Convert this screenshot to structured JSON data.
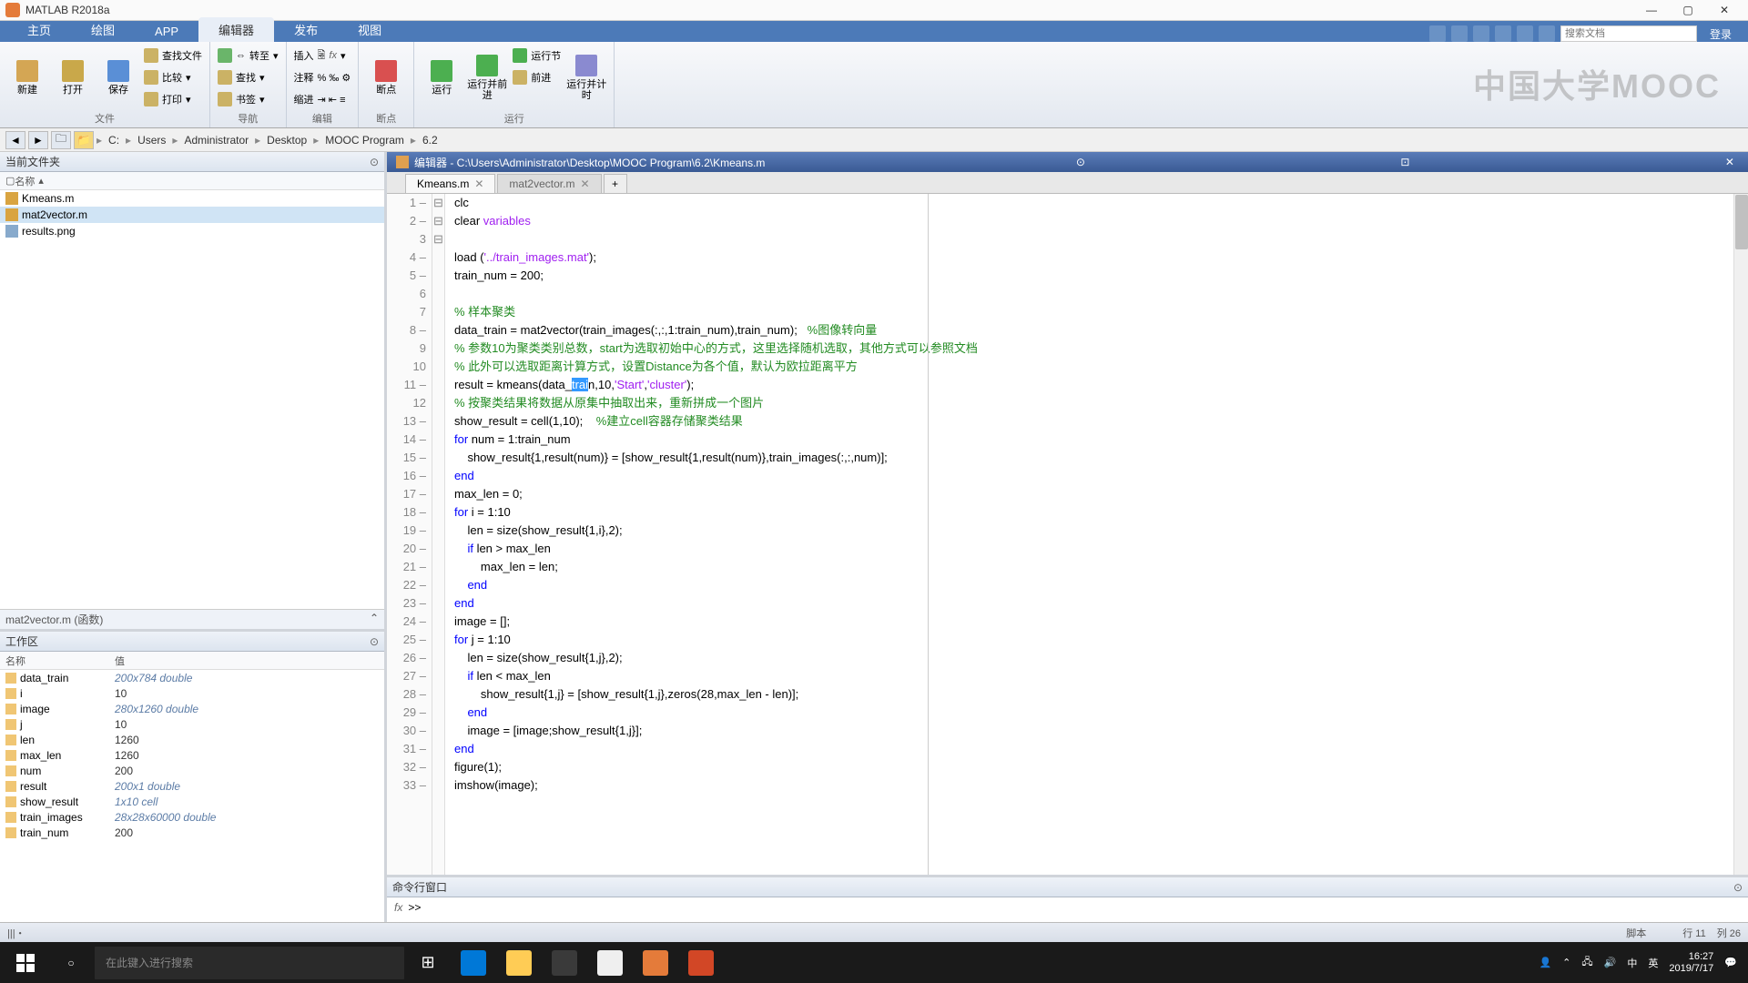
{
  "titlebar": {
    "title": "MATLAB R2018a"
  },
  "ribbon": {
    "tabs": [
      "主页",
      "绘图",
      "APP",
      "编辑器",
      "发布",
      "视图"
    ],
    "active_tab_index": 3,
    "login": "登录",
    "search_placeholder": "搜索文档",
    "groups": {
      "file_label": "文件",
      "nav_label": "",
      "edit_label": "编辑",
      "bp_label": "断点",
      "run_label": "运行",
      "new": "新建",
      "open": "打开",
      "save": "保存",
      "find_files": "查找文件",
      "compare": "比较",
      "print": "打印",
      "gonav": "转至",
      "find": "查找",
      "bookmark": "书签",
      "insert": "插入",
      "comment": "注释",
      "indent": "缩进",
      "fx": "fx",
      "breakpoints": "断点",
      "run": "运行",
      "run_advance": "运行并前进",
      "run_section": "运行节",
      "advance": "前进",
      "run_time": "运行并计时"
    }
  },
  "mooc_logo": "中国大学MOOC",
  "path": {
    "drive_label": "C:",
    "parts": [
      "Users",
      "Administrator",
      "Desktop",
      "MOOC Program",
      "6.2"
    ]
  },
  "panels": {
    "current_folder": "当前文件夹",
    "name_col": "名称",
    "workspace": "工作区",
    "name": "名称",
    "value": "值",
    "mat2vec_info": "mat2vector.m (函数)",
    "cmd_window": "命令行窗口"
  },
  "files": [
    {
      "name": "Kmeans.m",
      "type": "m"
    },
    {
      "name": "mat2vector.m",
      "type": "m",
      "selected": true
    },
    {
      "name": "results.png",
      "type": "png"
    }
  ],
  "workspace_vars": [
    {
      "name": "data_train",
      "value": "200x784 double",
      "italic": true
    },
    {
      "name": "i",
      "value": "10",
      "italic": false
    },
    {
      "name": "image",
      "value": "280x1260 double",
      "italic": true
    },
    {
      "name": "j",
      "value": "10",
      "italic": false
    },
    {
      "name": "len",
      "value": "1260",
      "italic": false
    },
    {
      "name": "max_len",
      "value": "1260",
      "italic": false
    },
    {
      "name": "num",
      "value": "200",
      "italic": false
    },
    {
      "name": "result",
      "value": "200x1 double",
      "italic": true
    },
    {
      "name": "show_result",
      "value": "1x10 cell",
      "italic": true
    },
    {
      "name": "train_images",
      "value": "28x28x60000 double",
      "italic": true
    },
    {
      "name": "train_num",
      "value": "200",
      "italic": false
    }
  ],
  "editor": {
    "header": "编辑器 - C:\\Users\\Administrator\\Desktop\\MOOC Program\\6.2\\Kmeans.m",
    "tabs": [
      {
        "label": "Kmeans.m",
        "active": true
      },
      {
        "label": "mat2vector.m",
        "active": false
      }
    ]
  },
  "code": {
    "sel_text": "trai",
    "lines": [
      {
        "n": 1,
        "dash": true,
        "raw": "clc"
      },
      {
        "n": 2,
        "dash": true,
        "pre": "clear ",
        "aft": "variables",
        "aftcls": "str"
      },
      {
        "n": 3,
        "raw": ""
      },
      {
        "n": 4,
        "dash": true,
        "pre": "load (",
        "aft": "'../train_images.mat'",
        "aftcls": "str",
        "tail": ");"
      },
      {
        "n": 5,
        "dash": true,
        "raw": "train_num = 200;"
      },
      {
        "n": 6,
        "raw": ""
      },
      {
        "n": 7,
        "cmt": "% 样本聚类"
      },
      {
        "n": 8,
        "dash": true,
        "custom": "l8"
      },
      {
        "n": 9,
        "cmt": "% 参数10为聚类类别总数，start为选取初始中心的方式，这里选择随机选取，其他方式可以参照文档"
      },
      {
        "n": 10,
        "cmt": "% 此外可以选取距离计算方式，设置Distance为各个值，默认为欧拉距离平方"
      },
      {
        "n": 11,
        "dash": true,
        "custom": "l11"
      },
      {
        "n": 12,
        "cmt": "% 按聚类结果将数据从原集中抽取出来，重新拼成一个图片"
      },
      {
        "n": 13,
        "dash": true,
        "pre": "show_result = cell(1,10);    ",
        "cmt2": "%建立cell容器存储聚类结果"
      },
      {
        "n": 14,
        "dash": true,
        "fold": "⊟",
        "kw1": "for",
        "aft2": " num = 1:train_num"
      },
      {
        "n": 15,
        "dash": true,
        "raw": "    show_result{1,result(num)} = [show_result{1,result(num)},train_images(:,:,num)];"
      },
      {
        "n": 16,
        "dash": true,
        "kw1": "end"
      },
      {
        "n": 17,
        "dash": true,
        "raw": "max_len = 0;"
      },
      {
        "n": 18,
        "dash": true,
        "fold": "⊟",
        "kw1": "for",
        "aft2": " i = 1:10"
      },
      {
        "n": 19,
        "dash": true,
        "raw": "    len = size(show_result{1,i},2);"
      },
      {
        "n": 20,
        "dash": true,
        "pre": "    ",
        "kw1": "if",
        "aft2": " len > max_len"
      },
      {
        "n": 21,
        "dash": true,
        "raw": "        max_len = len;"
      },
      {
        "n": 22,
        "dash": true,
        "pre": "    ",
        "kw1": "end"
      },
      {
        "n": 23,
        "dash": true,
        "kw1": "end"
      },
      {
        "n": 24,
        "dash": true,
        "raw": "image = [];"
      },
      {
        "n": 25,
        "dash": true,
        "fold": "⊟",
        "kw1": "for",
        "aft2": " j = 1:10"
      },
      {
        "n": 26,
        "dash": true,
        "raw": "    len = size(show_result{1,j},2);"
      },
      {
        "n": 27,
        "dash": true,
        "pre": "    ",
        "kw1": "if",
        "aft2": " len < max_len"
      },
      {
        "n": 28,
        "dash": true,
        "raw": "        show_result{1,j} = [show_result{1,j},zeros(28,max_len - len)];"
      },
      {
        "n": 29,
        "dash": true,
        "pre": "    ",
        "kw1": "end"
      },
      {
        "n": 30,
        "dash": true,
        "raw": "    image = [image;show_result{1,j}];"
      },
      {
        "n": 31,
        "dash": true,
        "kw1": "end"
      },
      {
        "n": 32,
        "dash": true,
        "raw": "figure(1);"
      },
      {
        "n": 33,
        "dash": true,
        "raw": "imshow(image);"
      }
    ],
    "l8_pre": "data_train = mat2vector(train_images(:,:,1:train_num),train_num);   ",
    "l8_cmt": "%图像转向量",
    "l11_pre": "result = kmeans(data_",
    "l11_aft": "n,10,",
    "l11_str1": "'Start'",
    "l11_mid": ",",
    "l11_str2": "'cluster'",
    "l11_tail": ");"
  },
  "statusbar": {
    "left": "|||・",
    "script": "脚本",
    "line": "行 11",
    "col": "列 26"
  },
  "taskbar": {
    "search": "在此键入进行搜索",
    "time": "16:27",
    "date": "2019/7/17",
    "ime1": "中",
    "ime2": "英"
  }
}
